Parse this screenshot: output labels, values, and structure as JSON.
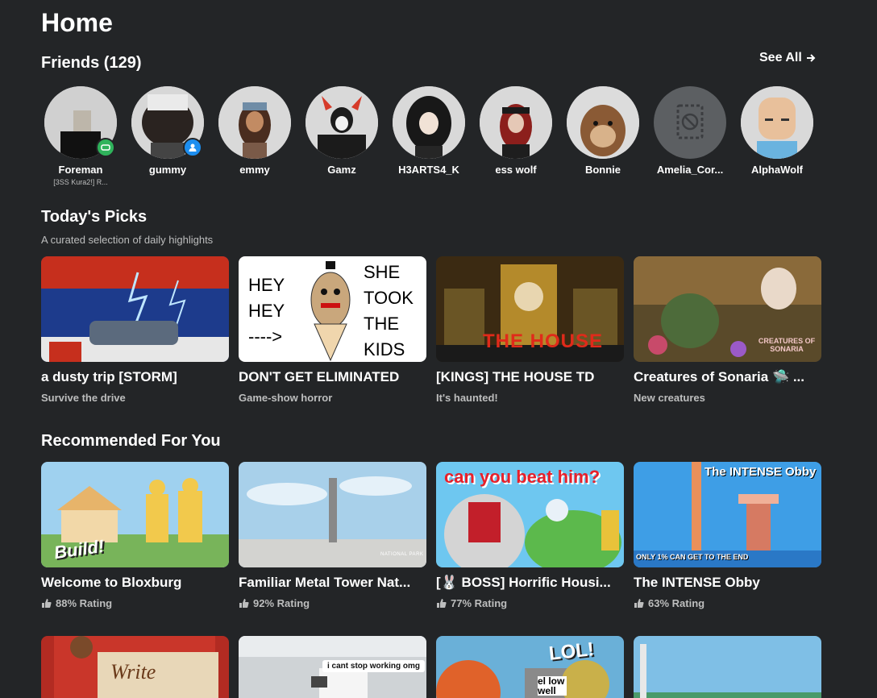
{
  "page": {
    "title": "Home"
  },
  "friends": {
    "title": "Friends (129)",
    "see_all": "See All",
    "list": [
      {
        "name": "Foreman",
        "sub": "[3SS Kura2!] R...",
        "presence": "game"
      },
      {
        "name": "gummy",
        "presence": "online"
      },
      {
        "name": "emmy"
      },
      {
        "name": "Gamz"
      },
      {
        "name": "H3ARTS4_K"
      },
      {
        "name": "ess wolf"
      },
      {
        "name": "Bonnie"
      },
      {
        "name": "Amelia_Cor..."
      },
      {
        "name": "AlphaWolf"
      }
    ]
  },
  "todays_picks": {
    "title": "Today's Picks",
    "subtitle": "A curated selection of daily highlights",
    "tiles": [
      {
        "title": "a dusty trip [STORM]",
        "sub": "Survive the drive"
      },
      {
        "title": "DON'T GET ELIMINATED",
        "sub": "Game-show horror",
        "thumb_left": "HEY\nHEY\n---->",
        "thumb_right": "SHE\nTOOK\nTHE\nKIDS"
      },
      {
        "title": "[KINGS] THE HOUSE TD",
        "sub": "It's haunted!",
        "thumb_text": "THE HOUSE"
      },
      {
        "title": "Creatures of Sonaria 🛸 ...",
        "sub": "New creatures",
        "thumb_text": "CREATURES OF SONARIA"
      }
    ]
  },
  "recommended": {
    "title": "Recommended For You",
    "tiles": [
      {
        "title": "Welcome to Bloxburg",
        "rating": "88% Rating",
        "thumb_text": "Build!"
      },
      {
        "title": "Familiar Metal Tower Nat...",
        "rating": "92% Rating",
        "thumb_text": "NATIONAL PARK"
      },
      {
        "title": "[🐰 BOSS] Horrific Housi...",
        "rating": "77% Rating",
        "thumb_text": "can you beat him?"
      },
      {
        "title": "The INTENSE Obby",
        "rating": "63% Rating",
        "thumb_text": "The INTENSE Obby",
        "thumb_sub": "ONLY 1% CAN GET TO THE END"
      }
    ]
  },
  "more": {
    "tiles": [
      {
        "thumb_text": "Write"
      },
      {
        "thumb_text": "i cant stop working omg"
      },
      {
        "thumb_text": "LOL!",
        "thumb_sub": "el low well"
      },
      {
        "thumb_text": ""
      }
    ]
  }
}
